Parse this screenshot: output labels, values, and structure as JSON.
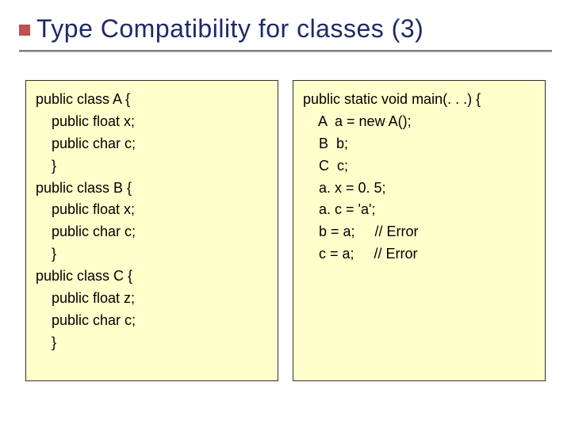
{
  "slide": {
    "title": "Type Compatibility for classes (3)"
  },
  "code_left": "public class A {\n    public float x;\n    public char c;\n    }\npublic class B {\n    public float x;\n    public char c;\n    }\npublic class C {\n    public float z;\n    public char c;\n    }",
  "code_right": "public static void main(. . .) {\n    A  a = new A();\n    B  b;\n    C  c;\n    a. x = 0. 5;\n    a. c = 'a';\n    b = a;     // Error\n    c = a;     // Error"
}
